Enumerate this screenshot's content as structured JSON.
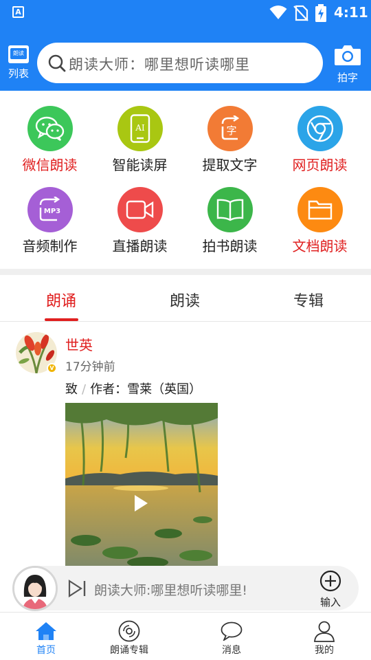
{
  "status_bar": {
    "time": "4:11",
    "app_icon_letter": "A"
  },
  "header": {
    "list_label": "列表",
    "list_icon_text": "朗读",
    "search_placeholder": "朗读大师：哪里想听读哪里",
    "camera_label": "拍字"
  },
  "features": [
    {
      "name": "微信朗读",
      "color": "#3cc75a",
      "icon": "wechat-icon",
      "highlight": true
    },
    {
      "name": "智能读屏",
      "color": "#a9c712",
      "icon": "ai-phone-icon",
      "icon_text": "AI",
      "highlight": false
    },
    {
      "name": "提取文字",
      "color": "#f27b35",
      "icon": "text-extract-icon",
      "icon_text": "字",
      "highlight": false
    },
    {
      "name": "网页朗读",
      "color": "#2ba4e8",
      "icon": "browser-icon",
      "highlight": true
    },
    {
      "name": "音频制作",
      "color": "#a55fd6",
      "icon": "mp3-icon",
      "icon_text": "MP3",
      "highlight": false
    },
    {
      "name": "直播朗读",
      "color": "#ee4b4b",
      "icon": "video-camera-icon",
      "highlight": false
    },
    {
      "name": "拍书朗读",
      "color": "#3cb64a",
      "icon": "open-book-icon",
      "highlight": false
    },
    {
      "name": "文档朗读",
      "color": "#fd8a11",
      "icon": "folder-icon",
      "highlight": true
    }
  ],
  "tabs": [
    {
      "label": "朗诵",
      "active": true
    },
    {
      "label": "朗读",
      "active": false
    },
    {
      "label": "专辑",
      "active": false
    }
  ],
  "post": {
    "author": "世英",
    "time": "17分钟前",
    "title_left": "致",
    "separator": "/",
    "title_right": "作者：雪莱（英国）",
    "badge": "V"
  },
  "player": {
    "text": "朗读大师:哪里想听读哪里!",
    "add_label": "输入"
  },
  "bottom_nav": [
    {
      "label": "首页",
      "icon": "home-icon",
      "active": true
    },
    {
      "label": "朗诵专辑",
      "icon": "disc-icon",
      "active": false
    },
    {
      "label": "消息",
      "icon": "message-icon",
      "active": false
    },
    {
      "label": "我的",
      "icon": "person-icon",
      "active": false
    }
  ],
  "colors": {
    "primary": "#1f82f5",
    "accent_red": "#e02020"
  }
}
